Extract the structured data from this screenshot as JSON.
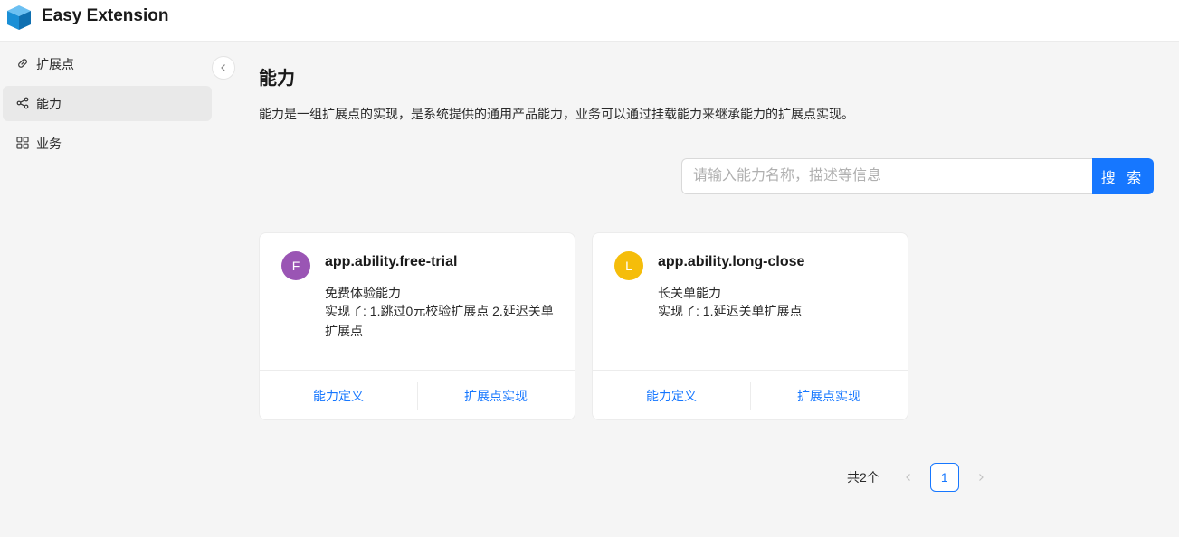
{
  "app": {
    "title": "Easy Extension",
    "accent": "#1677ff"
  },
  "sidebar": {
    "items": [
      {
        "label": "扩展点",
        "icon": "link-icon",
        "active": false
      },
      {
        "label": "能力",
        "icon": "share-nodes-icon",
        "active": true
      },
      {
        "label": "业务",
        "icon": "grid-icon",
        "active": false
      }
    ]
  },
  "main": {
    "title": "能力",
    "description": "能力是一组扩展点的实现，是系统提供的通用产品能力，业务可以通过挂载能力来继承能力的扩展点实现。",
    "search": {
      "placeholder": "请输入能力名称，描述等信息",
      "value": "",
      "button_label": "搜 索"
    },
    "cards": [
      {
        "avatar_letter": "F",
        "avatar_color": "#9a55b4",
        "name": "app.ability.free-trial",
        "desc": "免费体验能力",
        "impl": "实现了: 1.跳过0元校验扩展点 2.延迟关单扩展点",
        "action_definition": "能力定义",
        "action_impl": "扩展点实现"
      },
      {
        "avatar_letter": "L",
        "avatar_color": "#f5bd0a",
        "name": "app.ability.long-close",
        "desc": "长关单能力",
        "impl": "实现了: 1.延迟关单扩展点",
        "action_definition": "能力定义",
        "action_impl": "扩展点实现"
      }
    ],
    "pagination": {
      "total": "共2个",
      "current": "1"
    }
  }
}
